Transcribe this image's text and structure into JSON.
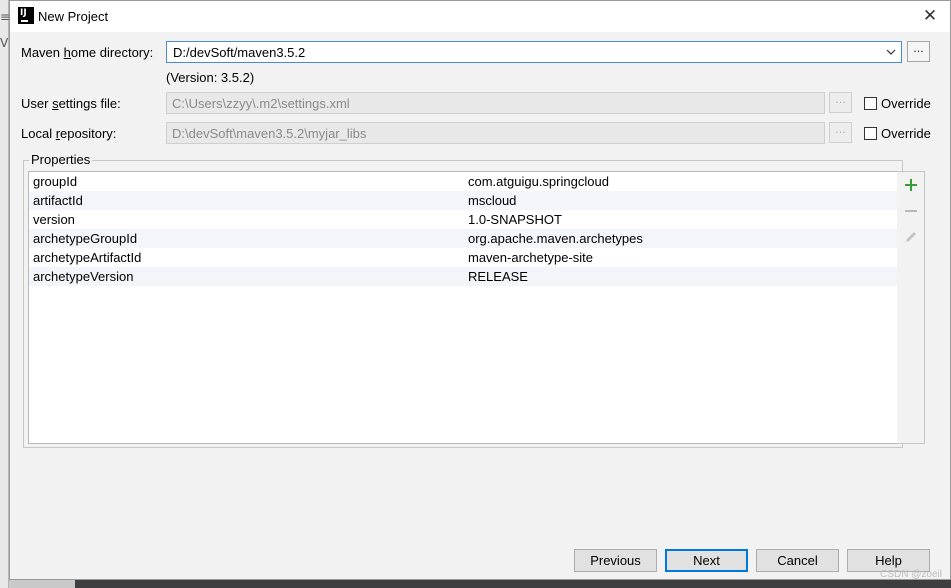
{
  "background": {
    "glyph_1": "≡",
    "glyph_2": "V"
  },
  "window": {
    "app_icon_text": "IJ",
    "title": "New Project"
  },
  "maven_home": {
    "label_pre": "Maven ",
    "label_mnemonic": "h",
    "label_post": "ome directory:",
    "value": "D:/devSoft/maven3.5.2",
    "browse_label": "...",
    "version_text": "(Version: 3.5.2)"
  },
  "user_settings": {
    "label_pre": "User ",
    "label_mnemonic": "s",
    "label_post": "ettings file:",
    "value": "C:\\Users\\zzyy\\.m2\\settings.xml",
    "browse_label": "...",
    "override_label": "Override",
    "override_checked": false
  },
  "local_repo": {
    "label_pre": "Local ",
    "label_mnemonic": "r",
    "label_post": "epository:",
    "value": "D:\\devSoft\\maven3.5.2\\myjar_libs",
    "browse_label": "...",
    "override_label": "Override",
    "override_checked": false
  },
  "properties": {
    "title": "Properties",
    "rows": [
      {
        "name": "groupId",
        "value": "com.atguigu.springcloud"
      },
      {
        "name": "artifactId",
        "value": "mscloud"
      },
      {
        "name": "version",
        "value": "1.0-SNAPSHOT"
      },
      {
        "name": "archetypeGroupId",
        "value": "org.apache.maven.archetypes"
      },
      {
        "name": "archetypeArtifactId",
        "value": "maven-archetype-site"
      },
      {
        "name": "archetypeVersion",
        "value": "RELEASE"
      }
    ],
    "toolbar": {
      "add_icon": "plus-icon",
      "remove_icon": "minus-icon",
      "edit_icon": "pencil-icon"
    }
  },
  "buttons": {
    "previous": "Previous",
    "next": "Next",
    "cancel": "Cancel",
    "help": "Help"
  },
  "watermark": "CSDN @zoeil",
  "colors": {
    "focus_border": "#4b8ad6",
    "default_button": "#0078d7",
    "add_icon": "#3a9a3a"
  }
}
